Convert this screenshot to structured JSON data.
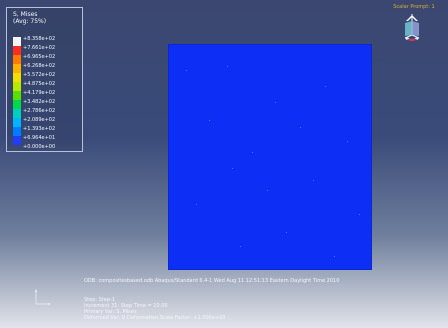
{
  "legend": {
    "title": "S, Mises",
    "subtitle": "(Avg: 75%)",
    "colors": [
      "#f4f4f4",
      "#ff2d1f",
      "#ff7a00",
      "#ffb300",
      "#f0e000",
      "#b6ea00",
      "#57e000",
      "#00d84b",
      "#00cfbf",
      "#00b4ff",
      "#007cff",
      "#1f3cff"
    ],
    "values": [
      "+8.358e+02",
      "+7.661e+02",
      "+6.965e+02",
      "+6.268e+02",
      "+5.572e+02",
      "+4.875e+02",
      "+4.179e+02",
      "+3.482e+02",
      "+2.786e+02",
      "+2.089e+02",
      "+1.393e+02",
      "+6.964e+01",
      "+0.000e+00"
    ]
  },
  "triad": {
    "top_label": "Scalar Prompt: 1"
  },
  "footer": {
    "odb_line": "ODB: compositesbased.odb    Abaqus/Standard 6.4-1    Wed Aug 11 12:51:13 Eastern Daylight Time 2010",
    "step_line": "Step: Step-1",
    "increment_line": "Increment    31: Step Time =    10.00",
    "primary_var_line": "Primary Var: S, Mises",
    "deformed_var_line": "Deformed Var: U   Deformation Scale Factor: +1.000e+00"
  }
}
